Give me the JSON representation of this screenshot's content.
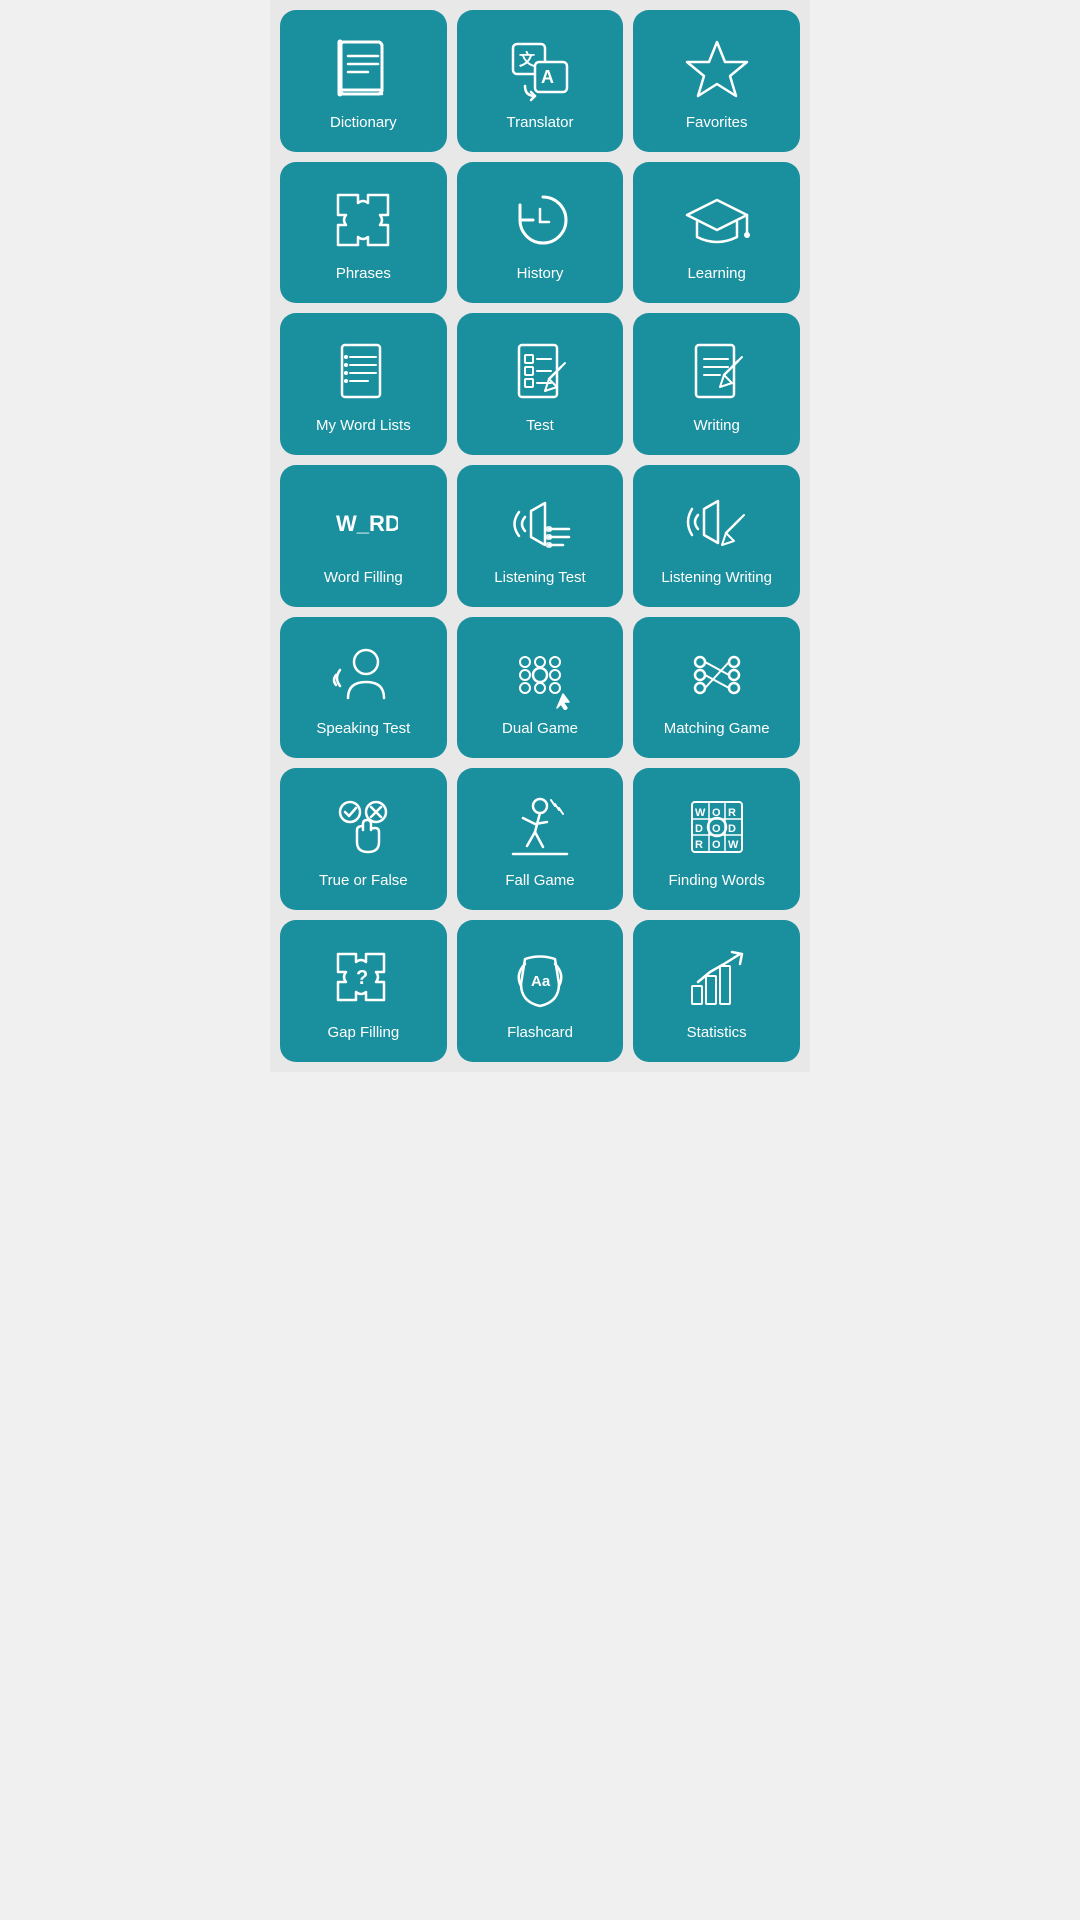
{
  "tiles": [
    {
      "id": "dictionary",
      "label": "Dictionary"
    },
    {
      "id": "translator",
      "label": "Translator"
    },
    {
      "id": "favorites",
      "label": "Favorites"
    },
    {
      "id": "phrases",
      "label": "Phrases"
    },
    {
      "id": "history",
      "label": "History"
    },
    {
      "id": "learning",
      "label": "Learning"
    },
    {
      "id": "my-word-lists",
      "label": "My Word Lists"
    },
    {
      "id": "test",
      "label": "Test"
    },
    {
      "id": "writing",
      "label": "Writing"
    },
    {
      "id": "word-filling",
      "label": "Word Filling"
    },
    {
      "id": "listening-test",
      "label": "Listening Test"
    },
    {
      "id": "listening-writing",
      "label": "Listening Writing"
    },
    {
      "id": "speaking-test",
      "label": "Speaking Test"
    },
    {
      "id": "dual-game",
      "label": "Dual Game"
    },
    {
      "id": "matching-game",
      "label": "Matching Game"
    },
    {
      "id": "true-or-false",
      "label": "True or False"
    },
    {
      "id": "fall-game",
      "label": "Fall Game"
    },
    {
      "id": "finding-words",
      "label": "Finding Words"
    },
    {
      "id": "gap-filling",
      "label": "Gap Filling"
    },
    {
      "id": "flashcard",
      "label": "Flashcard"
    },
    {
      "id": "statistics",
      "label": "Statistics"
    }
  ]
}
